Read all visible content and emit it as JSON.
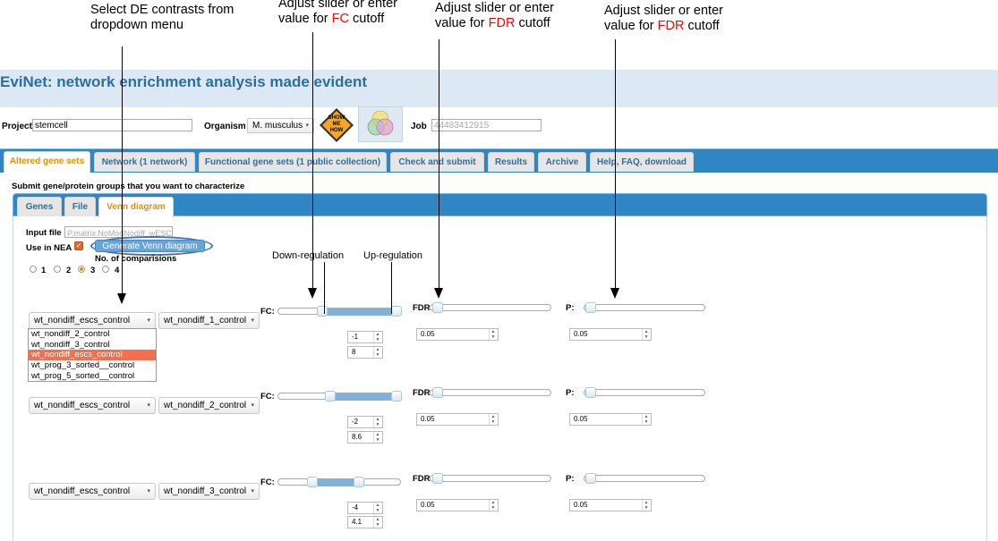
{
  "annotations": {
    "dropdown_hint_line1": "Select DE contrasts from",
    "dropdown_hint_line2": "dropdown menu",
    "fc_hint_line1": "Adjust slider or enter",
    "fc_hint_pre": "value for ",
    "fc_hint_red": "FC",
    "fc_hint_post": " cutoff",
    "fdr_hint_line1": "Adjust slider or enter",
    "fdr_hint_pre": "value for ",
    "fdr_hint_red": "FDR",
    "fdr_hint_post": " cutoff",
    "p_hint_line1": "Adjust slider or enter",
    "p_hint_pre": "value for ",
    "p_hint_red": "FDR",
    "p_hint_post": " cutoff",
    "down_regulation": "Down-regulation",
    "up_regulation": "Up-regulation"
  },
  "app": {
    "title": "EviNet: network enrichment analysis made evident"
  },
  "header": {
    "project_label": "Project",
    "project_value": "stemcell",
    "organism_label": "Organism",
    "organism_value": "M. musculus",
    "show_me_how_line1": "SHOW",
    "show_me_how_line2": "ME",
    "show_me_how_line3": "HOW",
    "job_label": "Job",
    "job_placeholder": "44483412915"
  },
  "tabs": [
    {
      "label": "Altered gene sets"
    },
    {
      "label": "Network (1 network)"
    },
    {
      "label": "Functional gene sets (1 public collection)"
    },
    {
      "label": "Check and submit"
    },
    {
      "label": "Results"
    },
    {
      "label": "Archive"
    },
    {
      "label": "Help, FAQ, download"
    }
  ],
  "section_title": "Submit gene/protein groups that you want to characterize",
  "subtabs": [
    {
      "label": "Genes"
    },
    {
      "label": "File"
    },
    {
      "label": "Venn diagram"
    }
  ],
  "venn": {
    "input_file_label": "Input file",
    "input_file_value": "P.matrix.NoModNodiff_wESC",
    "use_in_nea_label": "Use in NEA",
    "generate_button": "Generate Venn diagram",
    "no_comparisons_label": "No. of comparisions",
    "radio_options": [
      "1",
      "2",
      "3",
      "4"
    ],
    "radio_selected": "3",
    "dropdown_options": [
      "wt_nondiff_2_control",
      "wt_nondiff_3_control",
      "wt_nondiff_escs_control",
      "wt_prog_3_sorted__control",
      "wt_prog_5_sorted__control"
    ],
    "rows": [
      {
        "left_select": "wt_nondiff_escs_control",
        "right_select": "wt_nondiff_1_control",
        "fc_label": "FC:",
        "fc_low": "-1",
        "fc_high": "8",
        "fdr_label": "FDR:",
        "fdr_value": "0.05",
        "p_label": "P:",
        "p_value": "0.05"
      },
      {
        "left_select": "wt_nondiff_escs_control",
        "right_select": "wt_nondiff_2_control",
        "fc_label": "FC:",
        "fc_low": "-2",
        "fc_high": "8.6",
        "fdr_label": "FDR:",
        "fdr_value": "0.05",
        "p_label": "P:",
        "p_value": "0.05"
      },
      {
        "left_select": "wt_nondiff_escs_control",
        "right_select": "wt_nondiff_3_control",
        "fc_label": "FC:",
        "fc_low": "-4",
        "fc_high": "4.1",
        "fdr_label": "FDR:",
        "fdr_value": "0.05",
        "p_label": "P:",
        "p_value": "0.05"
      }
    ]
  }
}
